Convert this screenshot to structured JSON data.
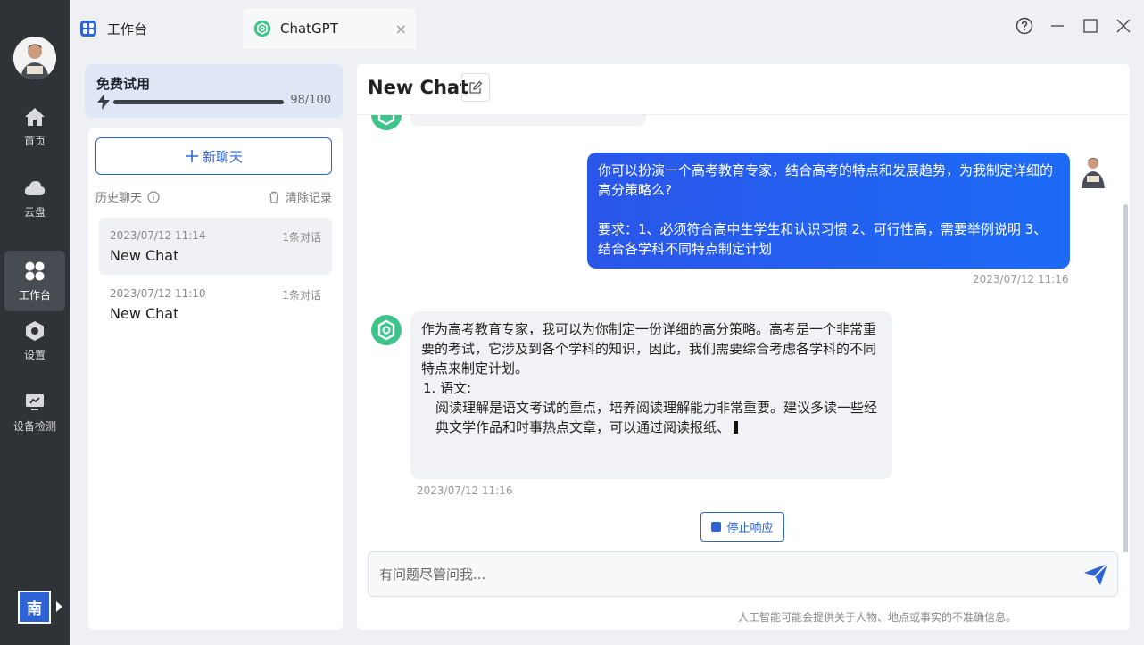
{
  "nav": {
    "items": [
      {
        "label": "首页",
        "icon": "home-icon"
      },
      {
        "label": "云盘",
        "icon": "cloud-icon"
      },
      {
        "label": "工作台",
        "icon": "grid-icon"
      },
      {
        "label": "设置",
        "icon": "settings-hex-icon"
      },
      {
        "label": "设备检测",
        "icon": "monitor-icon"
      }
    ],
    "active": "工作台",
    "lang_label": "南"
  },
  "tabs": [
    {
      "label": "工作台"
    },
    {
      "label": "ChatGPT",
      "close": "×"
    }
  ],
  "trial": {
    "title": "免费试用",
    "used": 98,
    "total": 100,
    "count_text": "98/100"
  },
  "sidebar": {
    "new_chat_label": "新聊天",
    "history_label": "历史聊天",
    "clear_label": "清除记录",
    "history": [
      {
        "date": "2023/07/12 11:14",
        "count": "1条对话",
        "title": "New Chat"
      },
      {
        "date": "2023/07/12 11:10",
        "count": "1条对话",
        "title": "New Chat"
      }
    ]
  },
  "chat": {
    "title": "New Chat",
    "user_message": {
      "line1": "你可以扮演一个高考教育专家，结合高考的特点和发展趋势，为我制定详细的高分策略么?",
      "line2": "要求：1、必须符合高中生学生和认识习惯 2、可行性高，需要举例说明 3、结合各学科不同特点制定计划",
      "time": "2023/07/12 11:16"
    },
    "bot_message": {
      "intro": "作为高考教育专家，我可以为你制定一份详细的高分策略。高考是一个非常重要的考试，它涉及到各个学科的知识，因此，我们需要综合考虑各学科的不同特点来制定计划。",
      "list_head": "1. 语文:",
      "list_body": "阅读理解是语文考试的重点，培养阅读理解能力非常重要。建议多读一些经典文学作品和时事热点文章，可以通过阅读报纸、",
      "time": "2023/07/12 11:16"
    },
    "stop_label": "停止响应",
    "input_placeholder": "有问题尽管问我...",
    "disclaimer": "人工智能可能会提供关于人物、地点或事实的不准确信息。"
  },
  "colors": {
    "accent": "#2e63d6",
    "rail": "#2f3237",
    "gpt_green": "#3ec48a"
  }
}
